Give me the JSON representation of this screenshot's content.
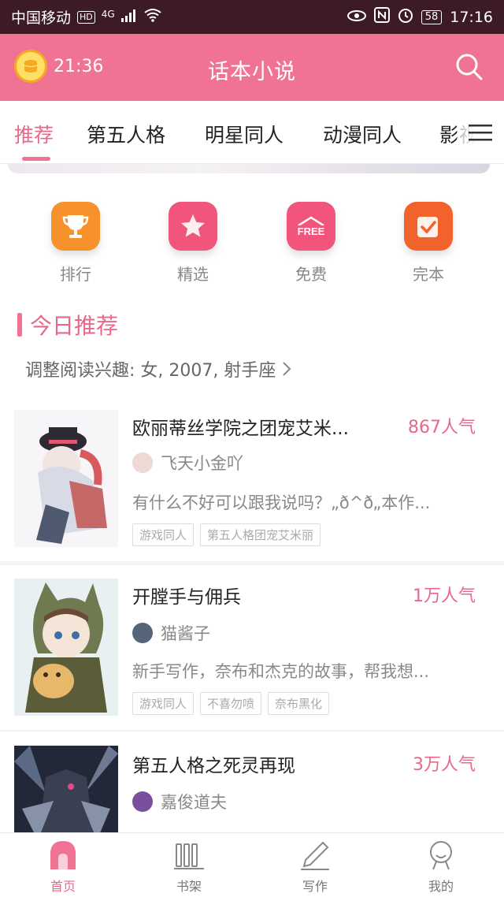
{
  "status_bar": {
    "carrier": "中国移动",
    "hd": "HD",
    "network": "4G",
    "battery": "58",
    "time": "17:16"
  },
  "header": {
    "timer": "21:36",
    "title": "话本小说",
    "search_icon": "search-icon"
  },
  "tabs": [
    {
      "label": "推荐"
    },
    {
      "label": "第五人格"
    },
    {
      "label": "明星同人"
    },
    {
      "label": "动漫同人"
    },
    {
      "label": "影视"
    }
  ],
  "quick_links": [
    {
      "label": "排行",
      "icon": "trophy-icon",
      "color": "#f7922a"
    },
    {
      "label": "精选",
      "icon": "star-icon",
      "color": "#f2557c"
    },
    {
      "label": "免费",
      "icon": "free-icon",
      "color": "#f2557c",
      "icon_text": "FREE"
    },
    {
      "label": "完本",
      "icon": "check-icon",
      "color": "#f2632b"
    }
  ],
  "section": {
    "title": "今日推荐",
    "interest": "调整阅读兴趣: 女, 2007, 射手座"
  },
  "books": [
    {
      "title": "欧丽蒂丝学院之团宠艾米...",
      "popularity": "867人气",
      "author": "飞天小金吖",
      "desc": "有什么不好可以跟我说吗？„ð^ð„本作...",
      "tags": [
        "游戏同人",
        "第五人格团宠艾米丽"
      ]
    },
    {
      "title": "开膛手与佣兵",
      "popularity": "1万人气",
      "author": "猫酱子",
      "desc": "新手写作，奈布和杰克的故事，帮我想...",
      "tags": [
        "游戏同人",
        "不喜勿喷",
        "奈布黑化"
      ]
    },
    {
      "title": "第五人格之死灵再现",
      "popularity": "3万人气",
      "author": "嘉俊道夫",
      "desc": "",
      "tags": []
    }
  ],
  "bottom_nav": [
    {
      "label": "首页",
      "icon": "home-icon"
    },
    {
      "label": "书架",
      "icon": "bookshelf-icon"
    },
    {
      "label": "写作",
      "icon": "pen-icon"
    },
    {
      "label": "我的",
      "icon": "profile-icon"
    }
  ],
  "colors": {
    "accent": "#f07394",
    "accent_text": "#e8688a",
    "status_bar": "#3d1b26"
  }
}
